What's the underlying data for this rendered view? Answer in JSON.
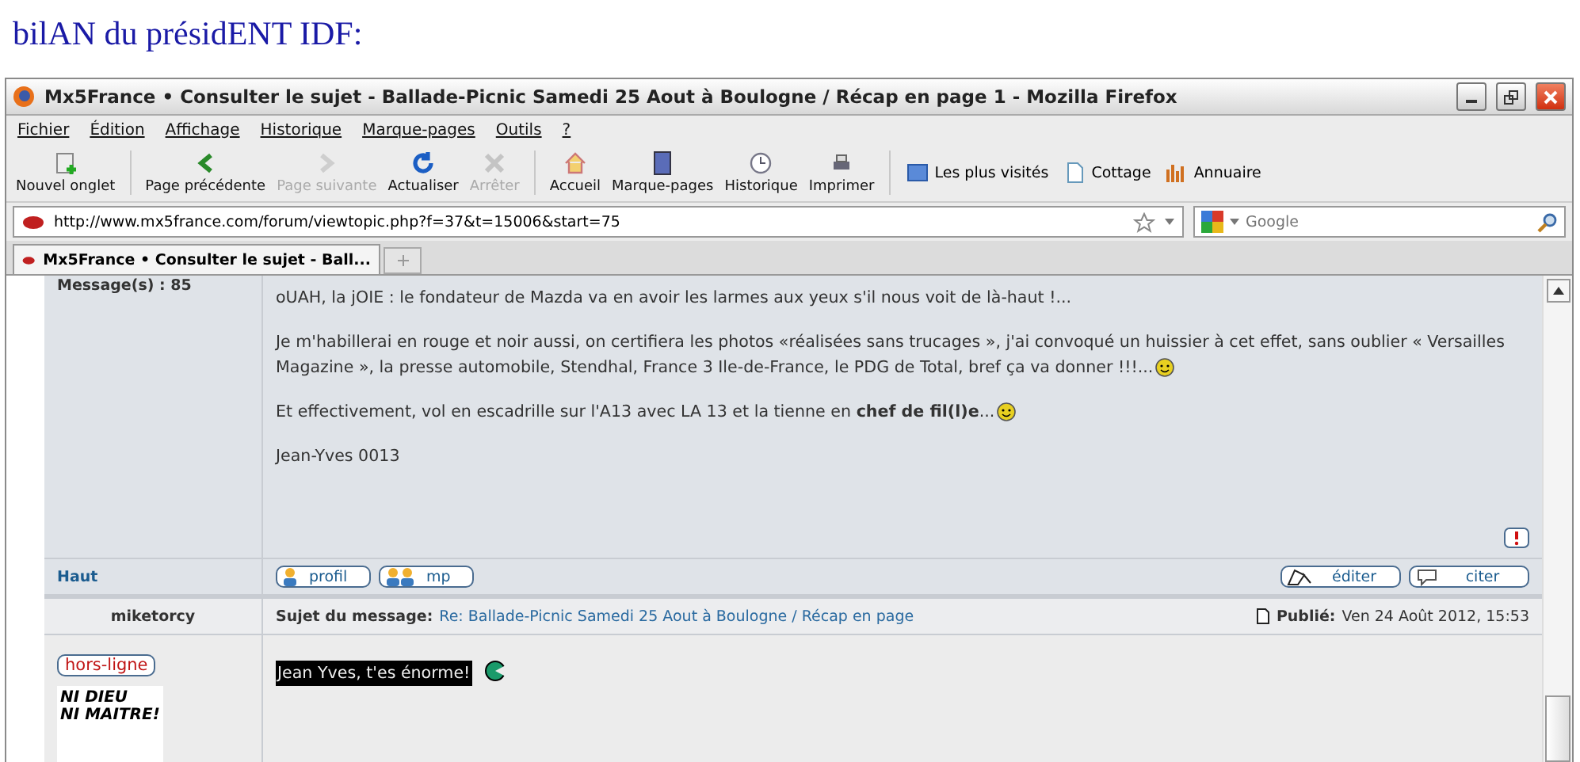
{
  "heading": "bilAN du présidENT IDF:",
  "window": {
    "title": "Mx5France • Consulter le sujet - Ballade-Picnic Samedi 25 Aout à Boulogne / Récap en page 1 - Mozilla Firefox"
  },
  "menu": [
    "Fichier",
    "Édition",
    "Affichage",
    "Historique",
    "Marque-pages",
    "Outils",
    "?"
  ],
  "toolbar": [
    {
      "label": "Nouvel onglet",
      "disabled": false
    },
    {
      "label": "Page précédente",
      "disabled": false
    },
    {
      "label": "Page suivante",
      "disabled": true
    },
    {
      "label": "Actualiser",
      "disabled": false
    },
    {
      "label": "Arrêter",
      "disabled": true
    },
    {
      "label": "Accueil",
      "disabled": false
    },
    {
      "label": "Marque-pages",
      "disabled": false
    },
    {
      "label": "Historique",
      "disabled": false
    },
    {
      "label": "Imprimer",
      "disabled": false
    }
  ],
  "bookmarks": [
    "Les plus visités",
    "Cottage",
    "Annuaire"
  ],
  "address": "http://www.mx5france.com/forum/viewtopic.php?f=37&t=15006&start=75",
  "search": {
    "placeholder": "Google"
  },
  "tab": {
    "label": "Mx5France • Consulter le sujet - Ball..."
  },
  "post": {
    "author_meta": "Message(s) : 85",
    "paragraphs": [
      {
        "text": "oUAH, la jOIE : le fondateur de Mazda va en avoir les larmes aux yeux s'il nous voit de là-haut !...",
        "smiley": false
      },
      {
        "text": "Je m'habillerai en rouge et noir aussi, on certifiera les photos «réalisées sans trucages », j'ai convoqué un huissier à cet effet, sans oublier « Versailles Magazine », la presse automobile, Stendhal, France 3 Ile-de-France, le PDG de Total, bref ça va donner !!!...",
        "smiley": true
      },
      {
        "text": "Et effectivement, vol en escadrille sur l'A13 avec LA 13 et la tienne en **chef de fil(l)e**...",
        "smiley": true
      },
      {
        "text": "Jean-Yves 0013",
        "smiley": false
      }
    ],
    "top_link": "Haut",
    "left_buttons": [
      "profil",
      "mp"
    ],
    "right_buttons": [
      "éditer",
      "citer"
    ]
  },
  "reply": {
    "author": "miketorcy",
    "subject_label": "Sujet du message:",
    "subject": "Re: Ballade-Picnic Samedi 25 Aout à Boulogne / Récap en page",
    "published_label": "Publié:",
    "published": "Ven 24 Août 2012, 15:53",
    "status": "hors-ligne",
    "avatar_text": [
      "NI DIEU",
      "NI MAITRE!"
    ],
    "message": "Jean Yves, t'es énorme!"
  }
}
